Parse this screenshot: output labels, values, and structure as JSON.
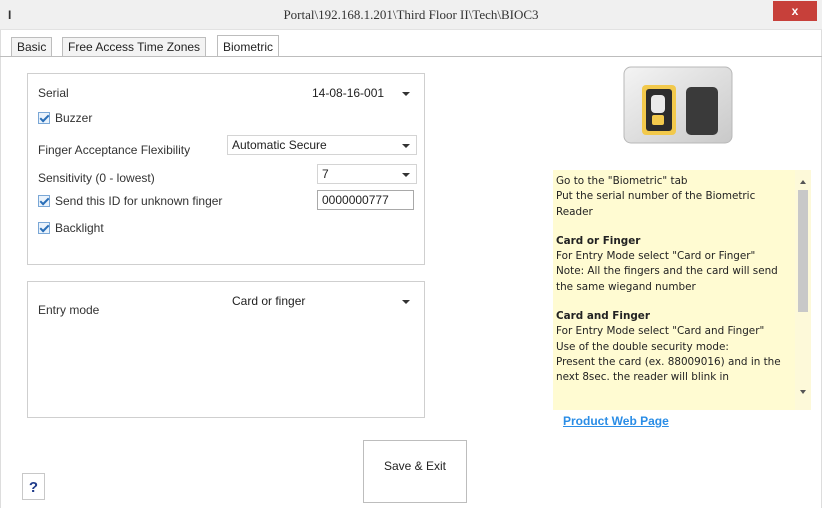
{
  "window": {
    "title": "Portal\\192.168.1.201\\Third Floor II\\Tech\\BIOC3",
    "close_label": "x",
    "app_icon": "I"
  },
  "tabs": [
    {
      "label": "Basic",
      "active": false
    },
    {
      "label": "Free Access Time Zones",
      "active": false
    },
    {
      "label": "Biometric",
      "active": true
    }
  ],
  "settings": {
    "serial_label": "Serial",
    "serial_value": "14-08-16-001",
    "buzzer_label": "Buzzer",
    "buzzer_checked": true,
    "finger_label": "Finger Acceptance Flexibility",
    "finger_value": "Automatic Secure",
    "sensitivity_label": "Sensitivity (0 - lowest)",
    "sensitivity_value": "7",
    "send_id_label": "Send this ID for unknown finger",
    "send_id_checked": true,
    "send_id_value": "0000000777",
    "backlight_label": "Backlight",
    "backlight_checked": true
  },
  "entry": {
    "label": "Entry mode",
    "value": "Card or finger"
  },
  "info": {
    "line1": "Go to the \"Biometric\" tab",
    "line2": "Put the serial number of the Biometric Reader",
    "card_or_finger_title": "Card or Finger",
    "card_or_finger_1": "For Entry Mode select \"Card or Finger\"",
    "card_or_finger_2": "Note: All the fingers and the card will send the same wiegand number",
    "card_and_finger_title": "Card and Finger",
    "card_and_finger_1": "For Entry Mode select \"Card and Finger\"",
    "card_and_finger_2": "Use of the double security mode:",
    "card_and_finger_3": "Present the card (ex. 88009016) and in the next 8sec. the reader will blink in"
  },
  "product_link": "Product Web Page",
  "save_button": "Save & Exit",
  "help_button": "?",
  "colors": {
    "close_button": "#c7403a",
    "info_background": "#fffbd2",
    "link": "#2a8de6",
    "checkbox_check": "#2b6fb8"
  },
  "icons": [
    "app-icon",
    "close-icon",
    "checkbox-icon",
    "dropdown-arrow-icon",
    "biometric-reader-image",
    "help-icon"
  ]
}
